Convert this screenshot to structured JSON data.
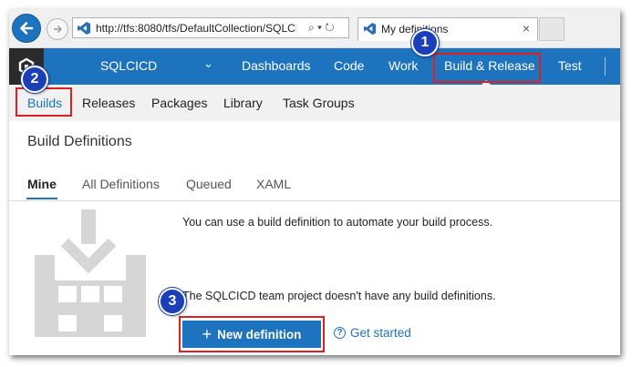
{
  "browser": {
    "address_url": "http://tfs:8080/tfs/DefaultCollection/SQLCI",
    "address_controls": "⌕ ▾ ↻",
    "tab_title": "My definitions",
    "tab_close": "×"
  },
  "topnav": {
    "project": "SQLCICD",
    "items": [
      {
        "label": "Dashboards"
      },
      {
        "label": "Code"
      },
      {
        "label": "Work"
      },
      {
        "label": "Build & Release"
      },
      {
        "label": "Test"
      }
    ]
  },
  "subnav": {
    "items": [
      {
        "label": "Builds"
      },
      {
        "label": "Releases"
      },
      {
        "label": "Packages"
      },
      {
        "label": "Library"
      },
      {
        "label": "Task Groups"
      }
    ]
  },
  "page": {
    "title": "Build Definitions",
    "tabs": [
      {
        "label": "Mine"
      },
      {
        "label": "All Definitions"
      },
      {
        "label": "Queued"
      },
      {
        "label": "XAML"
      }
    ],
    "message1": "You can use a build definition to automate your build process.",
    "message2": "The SQLCICD team project doesn't have any build definitions.",
    "new_definition_label": "New definition",
    "new_definition_plus": "+",
    "get_started_label": "Get started",
    "get_started_icon": "?"
  },
  "annotations": {
    "badges": [
      "1",
      "2",
      "3"
    ],
    "highlight_color": "#e02020",
    "badge_color": "#1a3fb8"
  },
  "colors": {
    "accent": "#1e73be",
    "subnav_bg": "#f1f1f1"
  }
}
